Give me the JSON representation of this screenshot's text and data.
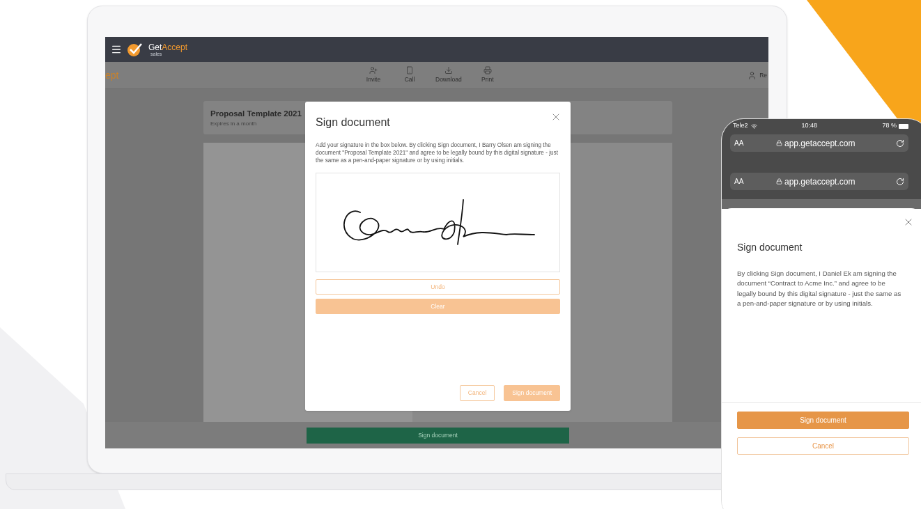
{
  "laptop": {
    "app_bar": {
      "brand": "Get",
      "brand_accent": "Accept",
      "brand_sub": "sales"
    },
    "toolbar": {
      "logo_fragment": "ept",
      "actions": [
        {
          "kind": "invite",
          "label": "Invite"
        },
        {
          "kind": "call",
          "label": "Call"
        },
        {
          "kind": "download",
          "label": "Download"
        },
        {
          "kind": "print",
          "label": "Print"
        }
      ],
      "user_fragment": "Re"
    },
    "document": {
      "title": "Proposal Template 2021",
      "subtitle": "Expires in a month"
    },
    "dialog": {
      "title": "Sign document",
      "text": "Add your signature in the box below. By clicking Sign document, I Barry Olsen am signing the document \"Proposal Template 2021\" and agree to be legally bound by this digital signature - just the same as a pen-and-paper signature or by using initials.",
      "pad_buttons": [
        {
          "kind": "outline",
          "label": "Undo"
        },
        {
          "kind": "filled",
          "label": "Clear"
        }
      ],
      "buttons": [
        {
          "kind": "outline",
          "label": "Cancel"
        },
        {
          "kind": "filled",
          "label": "Sign document"
        }
      ]
    },
    "footer_button": "Sign document"
  },
  "phone": {
    "status": {
      "carrier": "Tele2",
      "time": "10:48",
      "battery": "78 %"
    },
    "url_bars": [
      {
        "text_size": "AA",
        "url": "app.getaccept.com"
      },
      {
        "text_size": "AA",
        "url": "app.getaccept.com"
      }
    ],
    "sheet": {
      "title": "Sign document",
      "text": "By clicking Sign document, I Daniel Ek am signing the document “Contract to Acme Inc.” and agree to be legally bound by this digital signature - just the same as a pen-and-paper signature or by using initials.",
      "buttons": [
        {
          "kind": "filled",
          "label": "Sign document"
        },
        {
          "kind": "outline",
          "label": "Cancel"
        }
      ]
    }
  }
}
